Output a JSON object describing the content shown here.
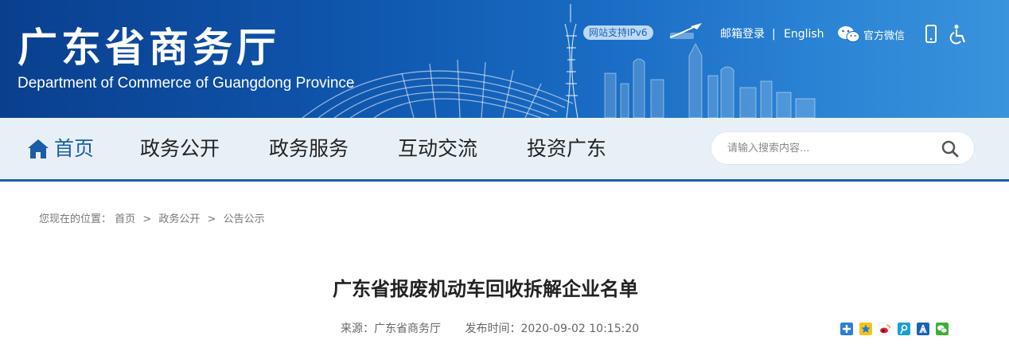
{
  "header": {
    "title": "广东省商务厅",
    "subtitle": "Department of Commerce of Guangdong Province",
    "ipv6_badge": "网站支持IPv6",
    "top_links": {
      "mailbox": "邮箱登录",
      "separator": "|",
      "english": "English",
      "wechat": "官方微信"
    }
  },
  "nav": {
    "items": [
      {
        "label": "首页"
      },
      {
        "label": "政务公开"
      },
      {
        "label": "政务服务"
      },
      {
        "label": "互动交流"
      },
      {
        "label": "投资广东"
      }
    ],
    "search_placeholder": "请输入搜索内容..."
  },
  "breadcrumb": {
    "prefix": "您现在的位置：",
    "items": [
      "首页",
      "政务公开",
      "公告公示"
    ],
    "separator": ">"
  },
  "article": {
    "title": "广东省报废机动车回收拆解企业名单",
    "source_label": "来源：广东省商务厅",
    "time_label": "发布时间：2020-09-02 10:15:20"
  },
  "share": {
    "icons": [
      "plus-share-icon",
      "qzone-icon",
      "weibo-icon",
      "tencent-weibo-icon",
      "renren-icon",
      "wechat-share-icon"
    ]
  },
  "colors": {
    "brand_blue": "#1a5ea8",
    "nav_bg": "#e8f0f7"
  }
}
